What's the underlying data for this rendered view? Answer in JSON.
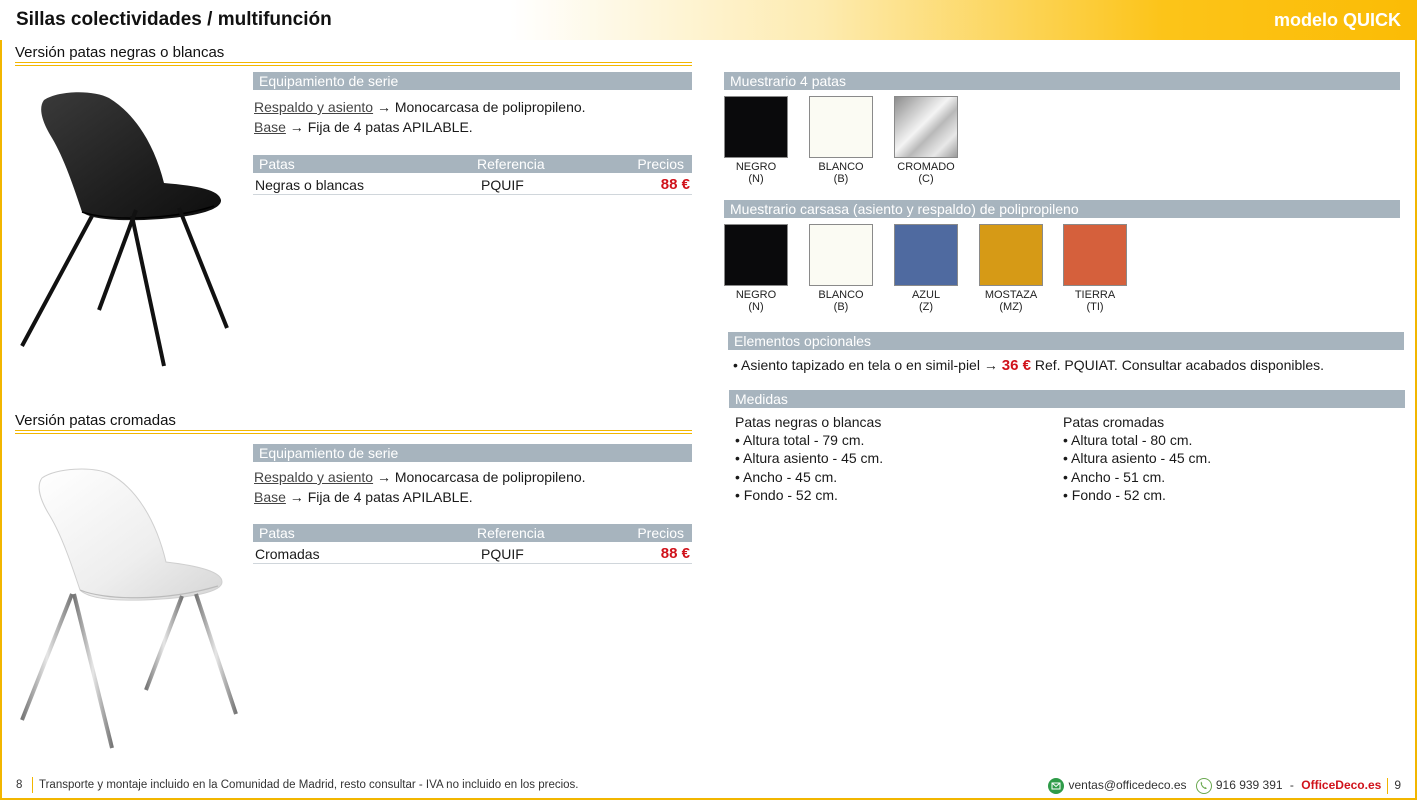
{
  "header": {
    "title": "Sillas colectividades / multifunción",
    "model": "modelo QUICK"
  },
  "version1": {
    "title": "Versión patas negras o blancas",
    "equip_title": "Equipamiento de serie",
    "line1_label": "Respaldo y asiento",
    "line1_text": " → Monocarcasa de polipropileno.",
    "line2_label": "Base",
    "line2_text": " → Fija de 4 patas APILABLE.",
    "table_head": {
      "col1": "Patas",
      "col2": "Referencia",
      "col3": "Precios"
    },
    "row": {
      "patas": "Negras o blancas",
      "ref": "PQUIF",
      "price": "88 €"
    }
  },
  "version2": {
    "title": "Versión patas cromadas",
    "equip_title": "Equipamiento de serie",
    "line1_label": "Respaldo y asiento",
    "line1_text": " → Monocarcasa de polipropileno.",
    "line2_label": "Base",
    "line2_text": " → Fija de 4 patas APILABLE.",
    "table_head": {
      "col1": "Patas",
      "col2": "Referencia",
      "col3": "Precios"
    },
    "row": {
      "patas": "Cromadas",
      "ref": "PQUIF",
      "price": "88 €"
    }
  },
  "legs_samples": {
    "title": "Muestrario 4 patas",
    "items": [
      {
        "name": "NEGRO",
        "code": "(N)",
        "color": "#0a0a0c"
      },
      {
        "name": "BLANCO",
        "code": "(B)",
        "color": "#fbfbf3"
      },
      {
        "name": "CROMADO",
        "code": "(C)",
        "color": "#c8c8c8"
      }
    ]
  },
  "shell_samples": {
    "title": "Muestrario carsasa (asiento y respaldo) de polipropileno",
    "items": [
      {
        "name": "NEGRO",
        "code": "(N)",
        "color": "#0a0a0c"
      },
      {
        "name": "BLANCO",
        "code": "(B)",
        "color": "#fbfbf3"
      },
      {
        "name": "AZUL",
        "code": "(Z)",
        "color": "#4f6aa0"
      },
      {
        "name": "MOSTAZA",
        "code": "(MZ)",
        "color": "#d69a16"
      },
      {
        "name": "TIERRA",
        "code": "(TI)",
        "color": "#d5603c"
      }
    ]
  },
  "optional": {
    "title": "Elementos opcionales",
    "bullet": "•",
    "text_before": "Asiento tapizado en tela o en simil-piel →",
    "price": "36 €",
    "text_after": "Ref. PQUIAT. Consultar acabados disponibles."
  },
  "measures": {
    "title": "Medidas",
    "col1": {
      "heading": "Patas negras o blancas",
      "items": [
        "• Altura total - 79 cm.",
        "• Altura asiento - 45 cm.",
        "• Ancho - 45 cm.",
        "• Fondo - 52 cm."
      ]
    },
    "col2": {
      "heading": "Patas cromadas",
      "items": [
        "• Altura total - 80 cm.",
        "• Altura asiento - 45 cm.",
        "• Ancho - 51 cm.",
        "• Fondo - 52 cm."
      ]
    }
  },
  "footer": {
    "page_left": "8",
    "note": "Transporte y montaje incluido en la Comunidad de Madrid, resto consultar - IVA no incluido en los precios.",
    "email": "ventas@officedeco.es",
    "phone": "916 939 391",
    "dash": "-",
    "brand": "OfficeDeco.es",
    "page_right": "9"
  },
  "colors": {
    "accent": "#f2b600",
    "bar": "#a7b4be",
    "price": "#d0121b"
  }
}
